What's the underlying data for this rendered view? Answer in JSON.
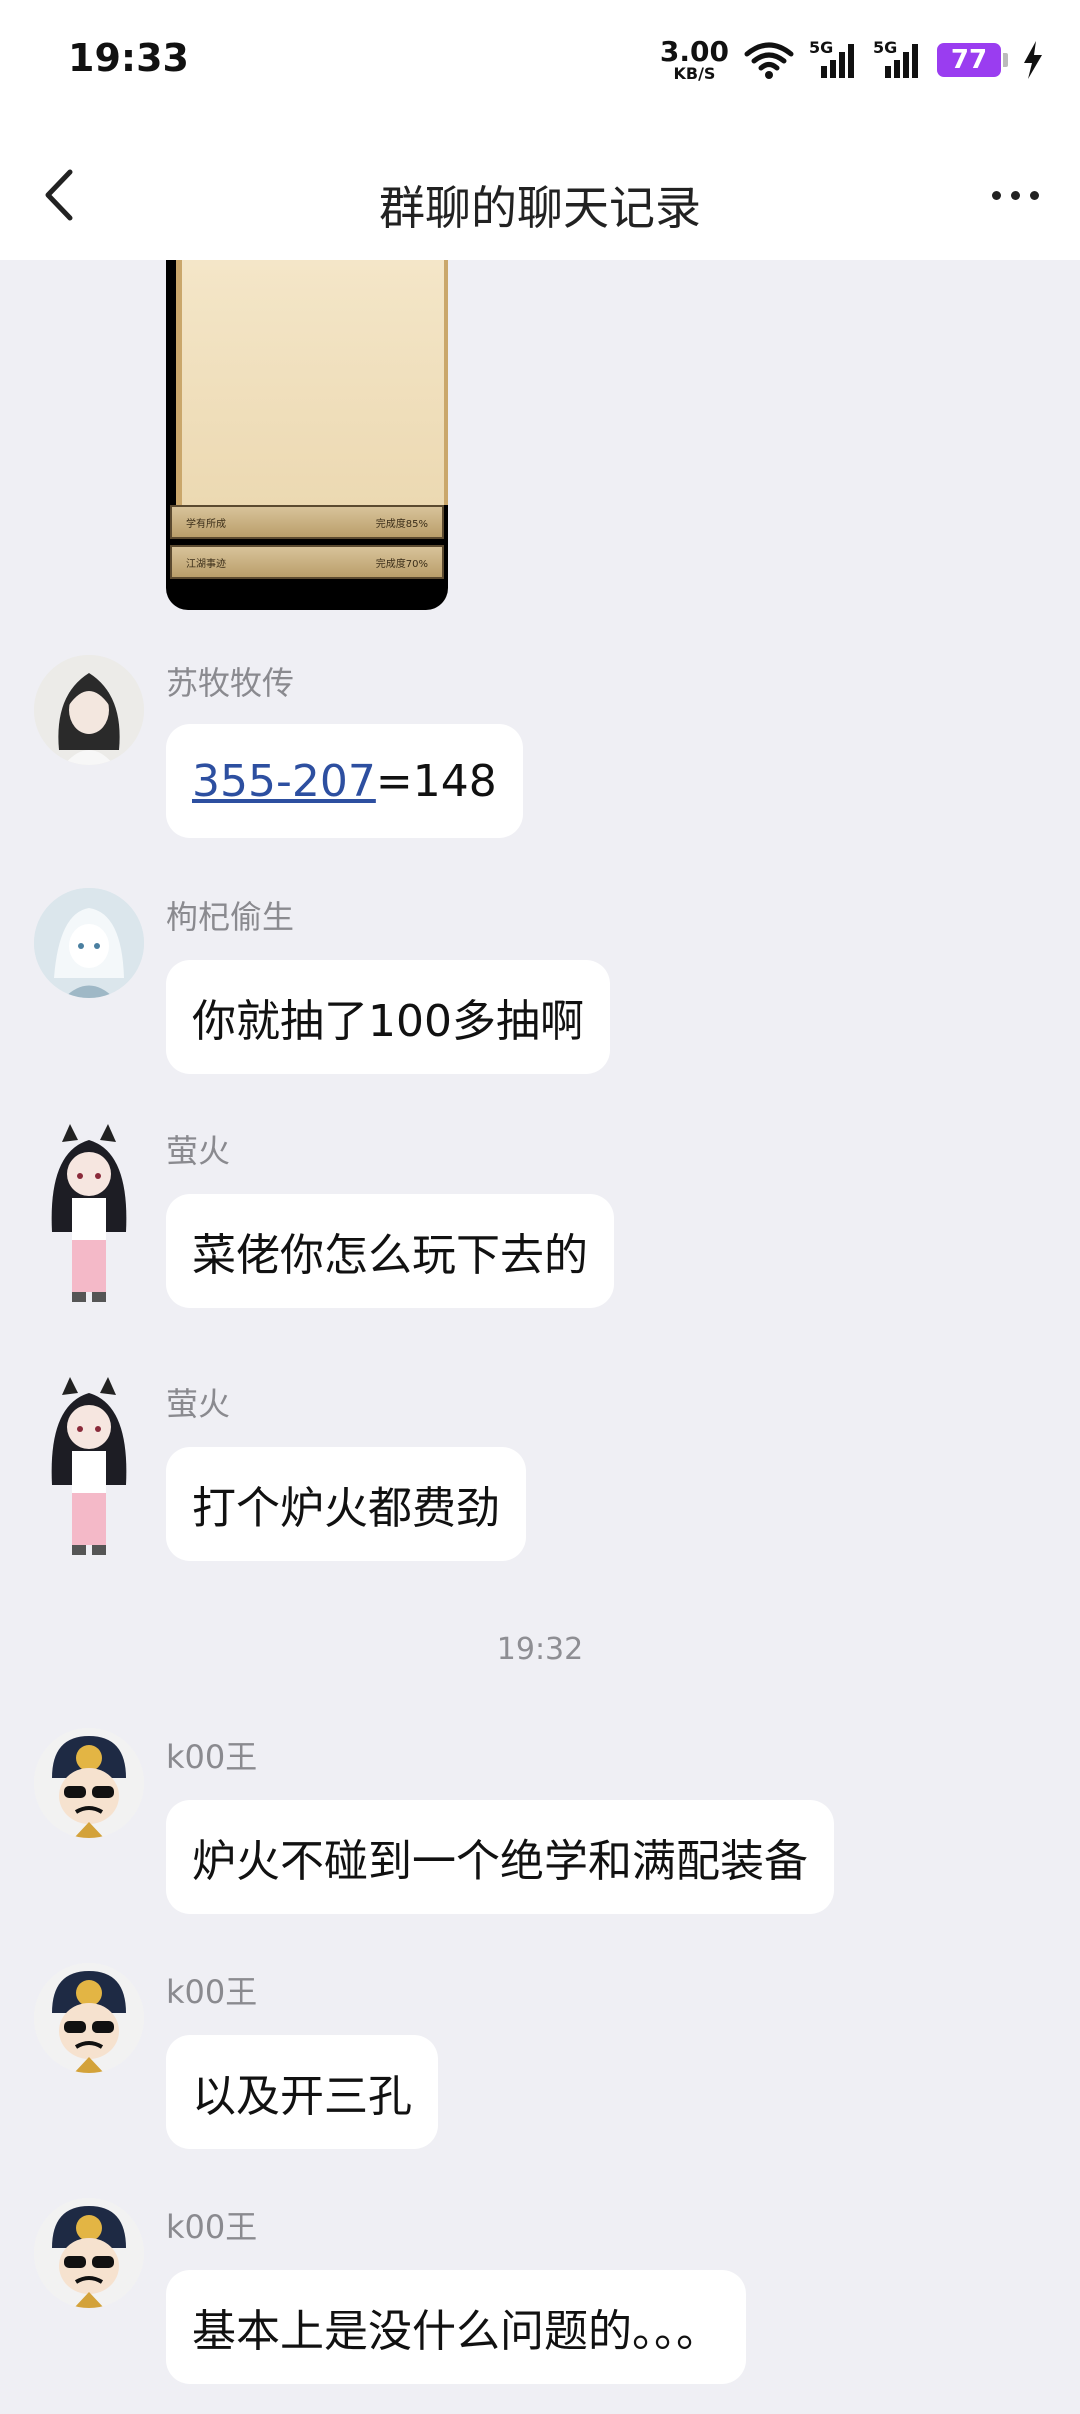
{
  "status_bar": {
    "time": "19:33",
    "net_speed_value": "3.00",
    "net_speed_unit": "KB/S",
    "signal1_label": "5G",
    "signal2_label": "5G",
    "battery": "77"
  },
  "header": {
    "title": "群聊的聊天记录"
  },
  "shared_image": {
    "bars": [
      {
        "label": "学有所成",
        "progress": "完成度85%"
      },
      {
        "label": "江湖事迹",
        "progress": "完成度70%"
      }
    ]
  },
  "messages": [
    {
      "sender": "苏牧牧传",
      "text_link": "355-207",
      "text": "=148"
    },
    {
      "sender": "枸杞偷生",
      "text": "你就抽了100多抽啊"
    },
    {
      "sender": "萤火",
      "text": "菜佬你怎么玩下去的"
    },
    {
      "sender": "萤火",
      "text": "打个炉火都费劲"
    },
    {
      "sender": "k00王",
      "text": "炉火不碰到一个绝学和满配装备"
    },
    {
      "sender": "k00王",
      "text": "以及开三孔"
    },
    {
      "sender": "k00王",
      "text": "基本上是没什么问题的。。。"
    }
  ],
  "time_separator": "19:32",
  "colors": {
    "background": "#efeff4",
    "bubble": "#ffffff",
    "link": "#2d4fa0",
    "battery": "#9a3df0"
  },
  "icons": {
    "back": "chevron-left-icon",
    "more": "more-dots-icon",
    "wifi": "wifi-icon",
    "signal": "cell-signal-icon",
    "charging": "lightning-icon"
  }
}
